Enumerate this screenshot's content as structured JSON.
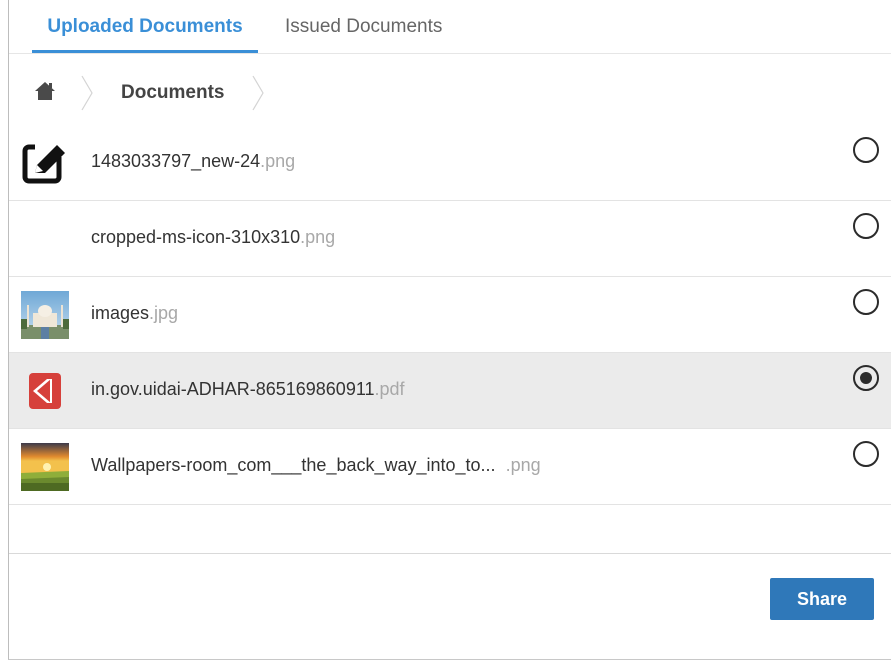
{
  "tabs": [
    {
      "label": "Uploaded Documents",
      "active": true
    },
    {
      "label": "Issued Documents",
      "active": false
    }
  ],
  "breadcrumb": {
    "home_icon": "home-icon",
    "current": "Documents"
  },
  "files": [
    {
      "name": "1483033797_new-24",
      "ext": ".png",
      "thumbnail": "edit-icon",
      "selected": false
    },
    {
      "name": "cropped-ms-icon-310x310",
      "ext": ".png",
      "thumbnail": "none",
      "selected": false
    },
    {
      "name": "images",
      "ext": ".jpg",
      "thumbnail": "photo-taj-mahal",
      "selected": false
    },
    {
      "name": "in.gov.uidai-ADHAR-865169860911",
      "ext": ".pdf",
      "thumbnail": "pdf-icon",
      "selected": true
    },
    {
      "name": "Wallpapers-room_com___the_back_way_into_to...",
      "ext": ".png",
      "thumbnail": "photo-sunset-landscape",
      "selected": false
    }
  ],
  "actions": {
    "share_label": "Share"
  },
  "colors": {
    "accent": "#3a8fd7",
    "button": "#2f78b9",
    "selected_row": "#ebebeb",
    "extension_text": "#a8a8a8"
  }
}
